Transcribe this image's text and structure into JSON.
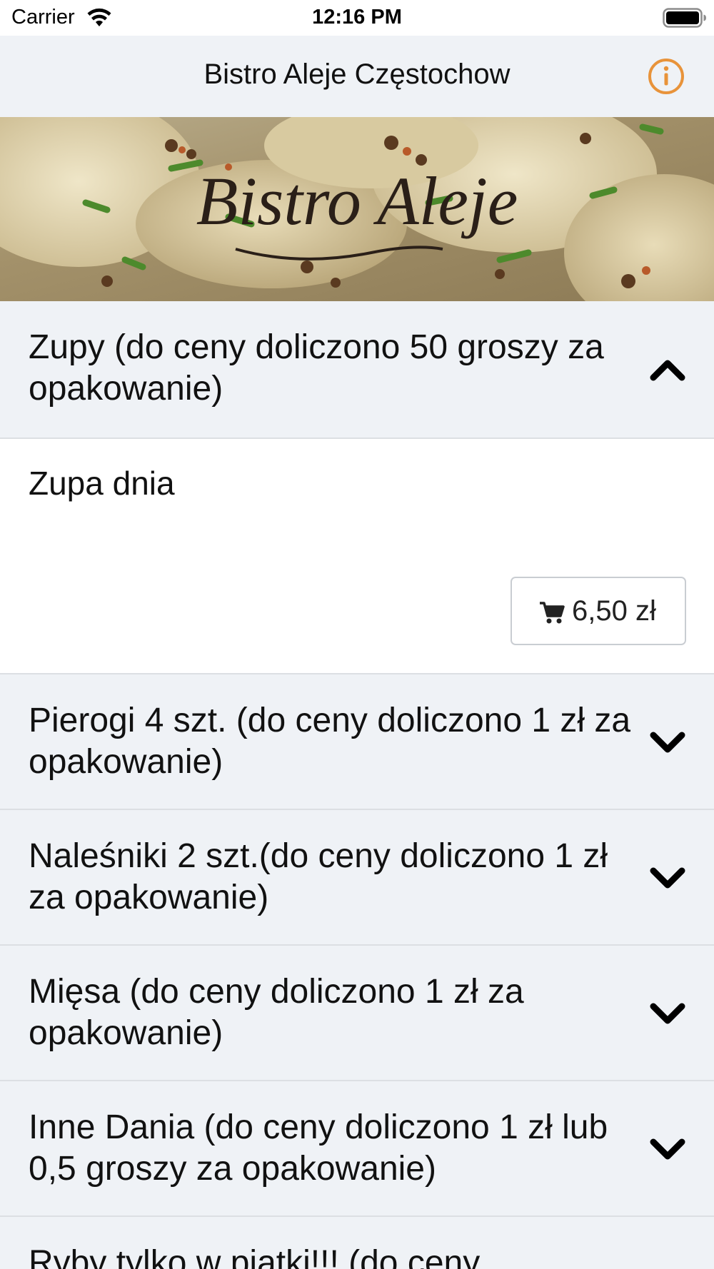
{
  "status_bar": {
    "carrier": "Carrier",
    "time": "12:16 PM",
    "icons": [
      "wifi-icon",
      "battery-icon"
    ]
  },
  "header": {
    "title": "Bistro Aleje Częstochow",
    "info_icon": "info-icon",
    "accent_color": "#e8933a"
  },
  "banner": {
    "logo_text": "Bistro Aleje"
  },
  "menu": {
    "categories": [
      {
        "label": "Zupy (do ceny doliczono 50 groszy za opakowanie)",
        "expanded": true,
        "icon": "chevron-up-icon",
        "items": [
          {
            "name": "Zupa dnia",
            "price": "6,50 zł",
            "icon": "cart-icon"
          }
        ]
      },
      {
        "label": "Pierogi 4 szt. (do ceny doliczono 1 zł za opakowanie)",
        "expanded": false,
        "icon": "chevron-down-icon"
      },
      {
        "label": "Naleśniki 2 szt.(do ceny doliczono 1 zł za opakowanie)",
        "expanded": false,
        "icon": "chevron-down-icon"
      },
      {
        "label": "Mięsa (do ceny doliczono 1 zł za opakowanie)",
        "expanded": false,
        "icon": "chevron-down-icon"
      },
      {
        "label": "Inne Dania (do ceny doliczono 1 zł lub 0,5 groszy za opakowanie)",
        "expanded": false,
        "icon": "chevron-down-icon"
      },
      {
        "label": "Ryby tylko w piątki!!! (do ceny",
        "expanded": false,
        "icon": "chevron-down-icon"
      }
    ]
  },
  "colors": {
    "nav_background": "#eff2f6",
    "row_background": "#eff2f6",
    "divider": "#dcdfe3",
    "text": "#111111"
  }
}
